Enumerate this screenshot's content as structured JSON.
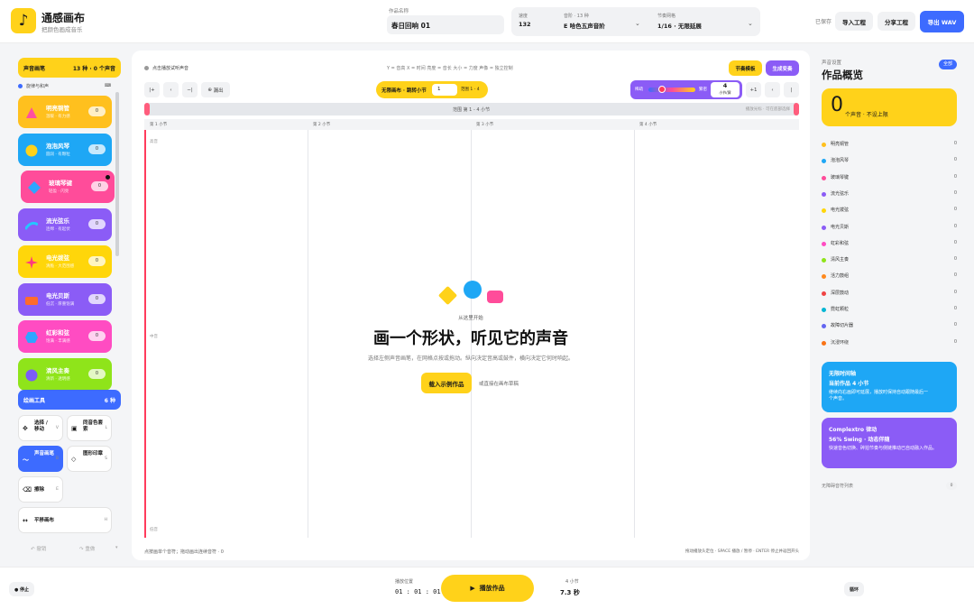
{
  "header": {
    "app_title": "通感画布",
    "app_subtitle": "把颜色画成音乐",
    "project_label": "作品名称",
    "project_name": "春日回响 01",
    "tempo_label": "速度",
    "tempo_value": "132",
    "scale_label": "音阶 · 13 种",
    "scale_value": "E 哈色五声音阶",
    "grid_label": "节奏网格",
    "grid_value": "1/16 · 无限延展",
    "saved_status": "已保存",
    "import_label": "导入工程",
    "share_label": "分享工程",
    "export_label": "导出 WAV"
  },
  "left": {
    "brush_title": "声音画笔",
    "brush_count": "13 种 · 0 个声音",
    "legend": "旋律与和声",
    "instruments": [
      {
        "name": "明亮铜管",
        "desc": "温暖 · 有力感",
        "count": "0",
        "color": "#ffc01e",
        "shape": "triangle",
        "shape_color": "#ff4fa0"
      },
      {
        "name": "泡泡风琴",
        "desc": "圆润 · 有颗粒",
        "count": "0",
        "color": "#1ea7f5",
        "shape": "circle",
        "shape_color": "#ffd21a"
      },
      {
        "name": "玻璃琴键",
        "desc": "轻盈 · 闪亮",
        "count": "0",
        "color": "#ff4c9a",
        "shape": "diamond",
        "shape_color": "#2ea6ff"
      },
      {
        "name": "流光弦乐",
        "desc": "连绵 · 有起伏",
        "count": "0",
        "color": "#8b5cf6",
        "shape": "wave",
        "shape_color": "#25c6ff"
      },
      {
        "name": "电光拨弦",
        "desc": "清脆 · 大范围感",
        "count": "0",
        "color": "#ffd60a",
        "shape": "star",
        "shape_color": "#ff3b7f"
      },
      {
        "name": "电光贝斯",
        "desc": "低沉 · 厚重饱满",
        "count": "0",
        "color": "#8b5cf6",
        "shape": "rect",
        "shape_color": "#ff6b2c"
      },
      {
        "name": "虹彩和弦",
        "desc": "饱满 · 丰满感",
        "count": "0",
        "color": "#ff4cc2",
        "shape": "hex",
        "shape_color": "#2ea6ff"
      },
      {
        "name": "清风主奏",
        "desc": "清新 · 透明感",
        "count": "0",
        "color": "#8fe41a",
        "shape": "circle",
        "shape_color": "#7c5cf6"
      }
    ],
    "tools_title": "绘画工具",
    "tools_count": "6 种",
    "tools": [
      {
        "label": "选择 / 移动",
        "key": "V",
        "icon": "✥"
      },
      {
        "label": "同音色套索",
        "key": "L",
        "icon": "▣"
      },
      {
        "label": "声音画笔",
        "key": "B",
        "icon": "〜"
      },
      {
        "label": "图形印章",
        "key": "S",
        "icon": "◇"
      },
      {
        "label": "擦除",
        "key": "E",
        "icon": "⌫"
      },
      {
        "label": "平移画布",
        "key": "H",
        "icon": "↔"
      }
    ],
    "undo_label": "撤销",
    "redo_label": "重做"
  },
  "canvas": {
    "hint": "点击播放试听声音",
    "axis_hint": "Y = 音高   X = 时间   亮度 = 音长   大小 = 力度   声像 = 独立控制",
    "template_btn": "节奏模板",
    "generate_btn": "生成变奏",
    "ruler_start": "|+",
    "zoom_label": "漏出",
    "infinite_label": "无限画布 · 跳转小节",
    "bar_input": "1",
    "bar_hint": "范围 1 - 4",
    "density_low": "稀疏",
    "density_high": "繁密",
    "bars_value": "4",
    "bars_unit": "小节/屏",
    "zoom_in": "+1",
    "prev": "‹",
    "next": "|",
    "progress_label": "范围 第 1 - 4 小节",
    "progress_right": "播放光标 · 可在底部选择",
    "bars": [
      "第 1 小节",
      "第 2 小节",
      "第 3 小节",
      "第 4 小节"
    ],
    "pitch_high": "高音",
    "pitch_mid": "中音",
    "pitch_low": "低音",
    "start_here": "从这里开始",
    "headline": "画一个形状，听见它的声音",
    "subline": "选择左侧声音画笔，在网格点按或拖动。纵向决定音高或鼓件，横向决定它何时响起。",
    "example_btn": "载入示例作品",
    "example_alt": "或直接在画布草稿",
    "bottom_left": "点按画单个音符；拖动画出连续音符 · 0",
    "bottom_right": "拖动播放头定位 · SPACE 播放 / 暂停 · ENTER 停止并返回开头"
  },
  "right": {
    "section_label": "声音设置",
    "title": "作品概览",
    "all_badge": "全部",
    "count_number": "0",
    "count_text": "个声音 · 不设上限",
    "rows": [
      {
        "name": "明亮铜管",
        "value": "0",
        "color": "#ffc01e"
      },
      {
        "name": "泡泡风琴",
        "value": "0",
        "color": "#1ea7f5"
      },
      {
        "name": "玻璃琴键",
        "value": "0",
        "color": "#ff4c9a"
      },
      {
        "name": "流光弦乐",
        "value": "0",
        "color": "#8b5cf6"
      },
      {
        "name": "电光拨弦",
        "value": "0",
        "color": "#ffd60a"
      },
      {
        "name": "电光贝斯",
        "value": "0",
        "color": "#8b5cf6"
      },
      {
        "name": "虹彩和弦",
        "value": "0",
        "color": "#ff4cc2"
      },
      {
        "name": "清风主奏",
        "value": "0",
        "color": "#8fe41a"
      },
      {
        "name": "活力鼓组",
        "value": "0",
        "color": "#ff8a1e"
      },
      {
        "name": "深层鼓动",
        "value": "0",
        "color": "#ef4444"
      },
      {
        "name": "霓虹颗粒",
        "value": "0",
        "color": "#06b6d4"
      },
      {
        "name": "故障切片器",
        "value": "0",
        "color": "#6366f1"
      },
      {
        "name": "沉浸环绕",
        "value": "0",
        "color": "#f97316"
      }
    ],
    "card1_title": "无限时间轴",
    "card1_value": "当前作品 4 小节",
    "card1_desc": "继续向右画即可延展，播放时保持自动跟随最后一个声音。",
    "card2_title": "Complextro 律动",
    "card2_value": "56% Swing · 动态伴随",
    "card2_desc": "快速音色切换、碎拍节奏与侧链推动已自动融入作品。",
    "empty_label": "无障碍音符列表",
    "empty_count": "0"
  },
  "footer": {
    "stop_label": "● 停止",
    "time_label": "播放位置",
    "time_value": "01 : 01 : 01",
    "play_label": "播放作品",
    "bars_label": "4 小节",
    "duration": "7.3 秒",
    "right_btn": "循环"
  },
  "colors": {
    "accent_yellow": "#ffd21a",
    "accent_blue": "#3d6bff",
    "accent_purple": "#8b5cf6"
  }
}
